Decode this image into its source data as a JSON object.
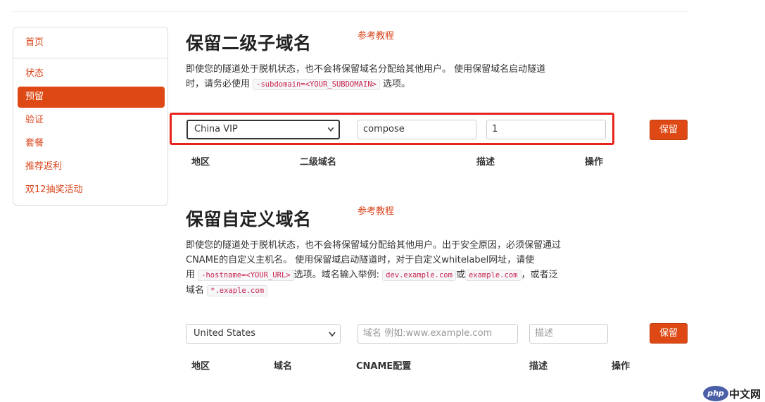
{
  "sidebar": {
    "items": [
      {
        "label": "首页"
      },
      {
        "label": "状态"
      },
      {
        "label": "预留"
      },
      {
        "label": "验证"
      },
      {
        "label": "套餐"
      },
      {
        "label": "推荐返利"
      },
      {
        "label": "双12抽奖活动"
      }
    ],
    "active_index": 2
  },
  "subdomain": {
    "title": "保留二级子域名",
    "ref_link": "参考教程",
    "desc_1": "即使您的隧道处于脱机状态，也不会将保留域名分配给其他用户。 使用保留域名启动隧道",
    "desc_2": "时，请务必使用",
    "desc_code": "-subdomain=<YOUR_SUBDOMAIN>",
    "desc_3": "选项。",
    "region_selected": "China VIP",
    "subdomain_value": "compose",
    "description_value": "1",
    "save_label": "保留",
    "columns": [
      "地区",
      "二级域名",
      "描述",
      "操作"
    ]
  },
  "custom": {
    "title": "保留自定义域名",
    "ref_link": "参考教程",
    "desc_1": "即使您的隧道处于脱机状态，也不会将保留域分配给其他用户。出于安全原因，必须保留通过",
    "desc_2": "CNAME的自定义主机名。 使用保留域启动隧道时，对于自定义whitelabel网址，请使",
    "desc_3a": "用",
    "desc_code1": "-hostname=<YOUR_URL>",
    "desc_3b": "选项。域名输入举例:",
    "desc_code2": "dev.example.com",
    "desc_3c": "或",
    "desc_code3": "example.com",
    "desc_3d": "，或者泛",
    "desc_4a": "域名",
    "desc_code4": "*.exaple.com",
    "region_selected": "United States",
    "domain_placeholder": "域名 例如:www.example.com",
    "description_placeholder": "描述",
    "save_label": "保留",
    "columns": [
      "地区",
      "域名",
      "CNAME配置",
      "描述",
      "操作"
    ]
  },
  "watermark": {
    "badge": "php",
    "text": "中文网"
  },
  "colors": {
    "accent": "#dd4814",
    "highlight": "#e8231d",
    "link": "#d9441a"
  }
}
